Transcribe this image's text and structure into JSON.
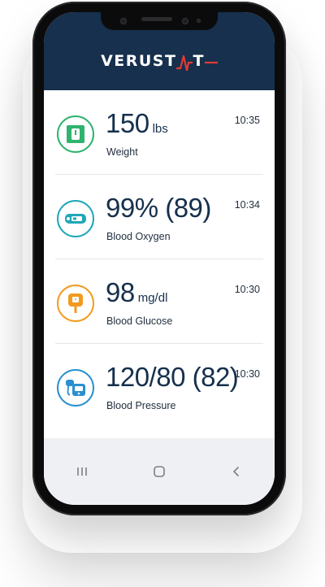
{
  "app": {
    "brand": "VERUSTAT",
    "brand_prefix": "VERUST",
    "brand_suffix": "T",
    "accent_color": "#e53935",
    "header_color": "#16304d"
  },
  "readings": [
    {
      "value": "150",
      "unit": "lbs",
      "label": "Weight",
      "time": "10:35",
      "icon": "scale-icon",
      "color": "#2fb36d"
    },
    {
      "value": "99% (89)",
      "unit": "",
      "label": "Blood Oxygen",
      "time": "10:34",
      "icon": "pulse-oximeter-icon",
      "color": "#1fa7b8"
    },
    {
      "value": "98",
      "unit": "mg/dl",
      "label": "Blood Glucose",
      "time": "10:30",
      "icon": "glucose-meter-icon",
      "color": "#f39a1e"
    },
    {
      "value": "120/80 (82)",
      "unit": "",
      "label": "Blood Pressure",
      "time": "10:30",
      "icon": "blood-pressure-cuff-icon",
      "color": "#2a8fd0"
    }
  ],
  "navbar": {
    "buttons": [
      "recent-apps-icon",
      "home-icon",
      "back-icon"
    ]
  }
}
